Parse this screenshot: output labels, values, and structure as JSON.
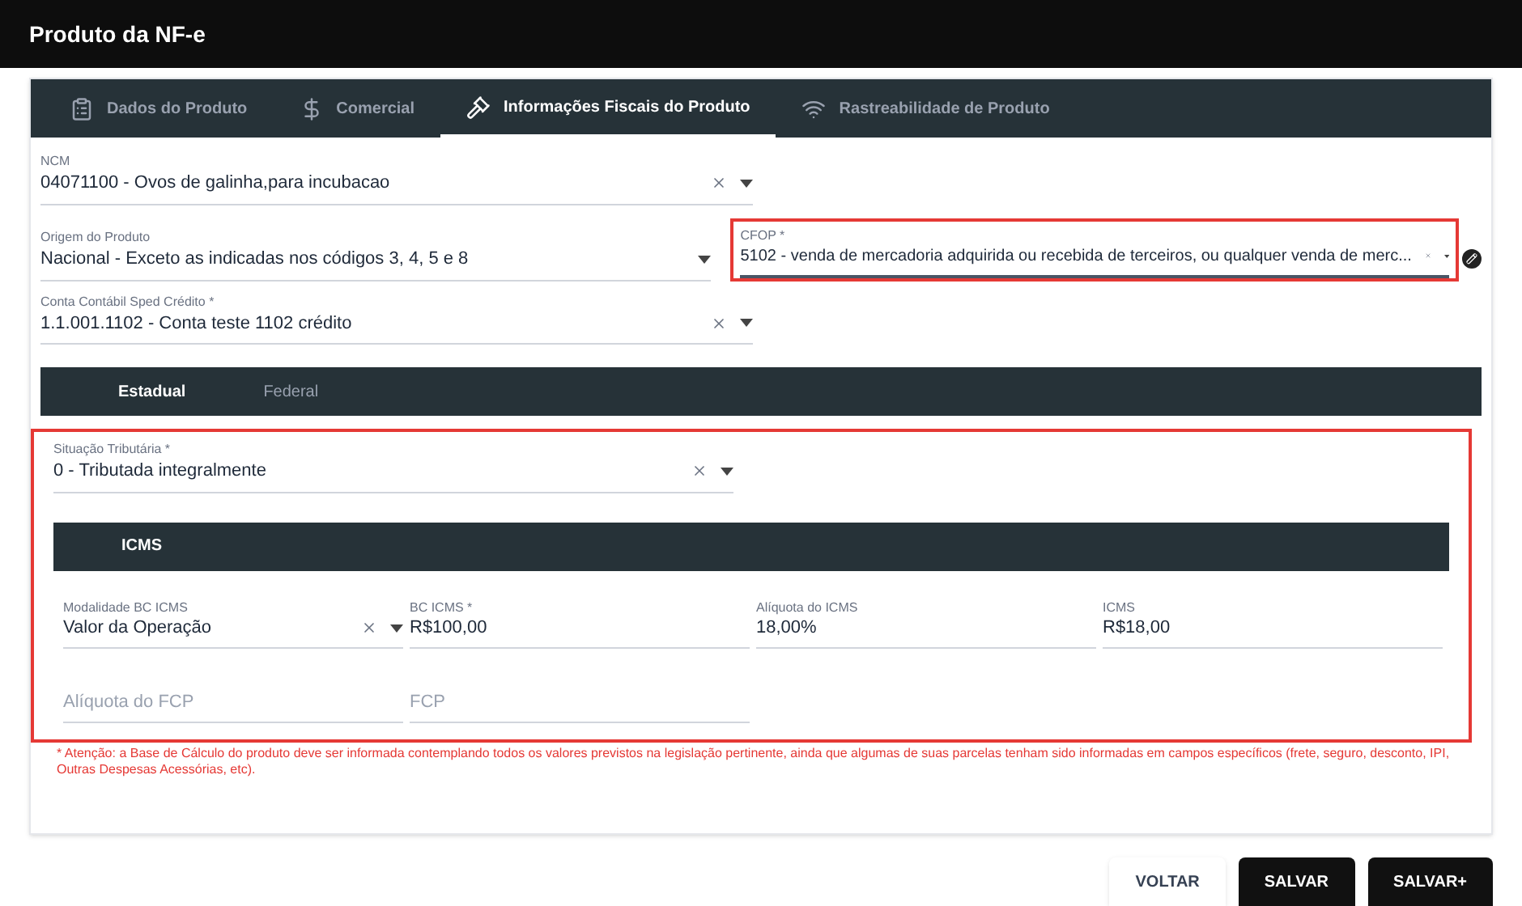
{
  "window": {
    "title": "Produto da NF-e"
  },
  "tabs": [
    {
      "label": "Dados do Produto",
      "selected": false
    },
    {
      "label": "Comercial",
      "selected": false
    },
    {
      "label": "Informações Fiscais do Produto",
      "selected": true
    },
    {
      "label": "Rastreabilidade de Produto",
      "selected": false
    }
  ],
  "fields": [
    {
      "label": "NCM",
      "value": "04071100 - Ovos de galinha,para incubacao",
      "clearable": true,
      "highlighted": false
    },
    {
      "label": "Origem do Produto",
      "value": "Nacional - Exceto as indicadas nos códigos 3, 4, 5 e 8",
      "clearable": false,
      "highlighted": false
    },
    {
      "label": "CFOP *",
      "value": "5102 - venda de mercadoria adquirida ou recebida de terceiros, ou qualquer venda de merc...",
      "clearable": true,
      "highlighted": true
    },
    {
      "label": "Conta Contábil Sped Crédito *",
      "value": "1.1.001.1102 - Conta teste 1102 crédito",
      "clearable": true,
      "highlighted": false
    }
  ],
  "tax_tabs": [
    {
      "label": "Estadual",
      "selected": true
    },
    {
      "label": "Federal",
      "selected": false
    }
  ],
  "situacao": {
    "label": "Situação Tributária *",
    "value": "0 - Tributada integralmente",
    "clearable": true
  },
  "icms_section": {
    "title": "ICMS"
  },
  "icms_fields": [
    {
      "kind": "select",
      "label": "Modalidade BC ICMS",
      "value": "Valor da Operação"
    },
    {
      "kind": "input",
      "label": "BC ICMS *",
      "value": "R$100,00"
    },
    {
      "kind": "input",
      "label": "Alíquota do ICMS",
      "value": "18,00%"
    },
    {
      "kind": "input",
      "label": "ICMS",
      "value": "R$18,00"
    },
    {
      "kind": "input",
      "placeholder": "Alíquota do FCP"
    },
    {
      "kind": "input",
      "placeholder": "FCP"
    }
  ],
  "note": "* Atenção: a Base de Cálculo do produto deve ser informada contemplando todos os valores previstos na legislação pertinente, ainda que algumas de suas parcelas tenham sido informadas em campos específicos (frete, seguro, desconto, IPI, Outras Despesas Acessórias, etc).",
  "buttons": [
    {
      "label": "VOLTAR",
      "kind": "flat"
    },
    {
      "label": "SALVAR",
      "kind": "dark"
    },
    {
      "label": "SALVAR+",
      "kind": "dark"
    }
  ]
}
